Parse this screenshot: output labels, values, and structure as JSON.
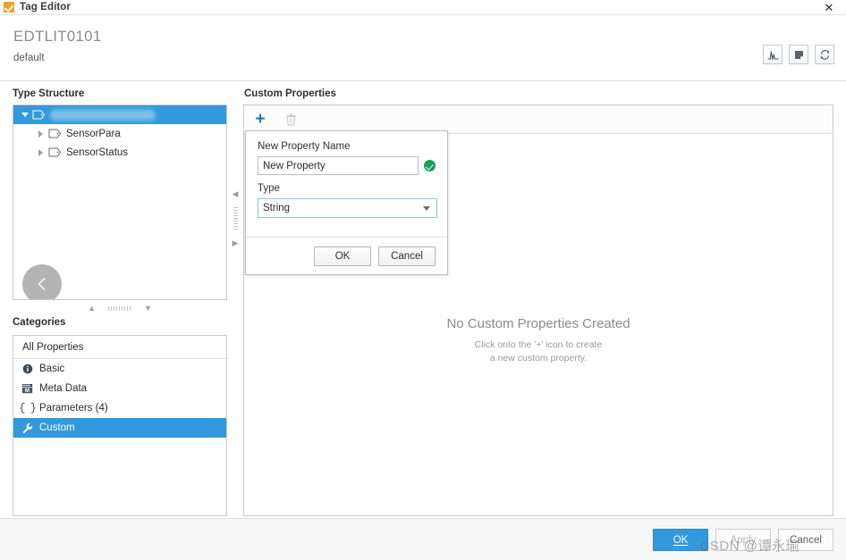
{
  "window": {
    "title": "Tag Editor",
    "icon": "tag-editor-icon",
    "close_label": "✕"
  },
  "header": {
    "title": "EDTLIT0101",
    "subtitle": "default",
    "tools": [
      {
        "name": "trend-chart-icon",
        "title": "Trend"
      },
      {
        "name": "note-icon",
        "title": "Note"
      },
      {
        "name": "refresh-icon",
        "title": "Refresh"
      }
    ]
  },
  "type_structure": {
    "label": "Type Structure",
    "nodes": [
      {
        "label": "",
        "redacted": true,
        "expanded": true,
        "selected": true,
        "level": 0
      },
      {
        "label": "SensorPara",
        "redacted": false,
        "expanded": false,
        "selected": false,
        "level": 1
      },
      {
        "label": "SensorStatus",
        "redacted": false,
        "expanded": false,
        "selected": false,
        "level": 1
      }
    ],
    "back_button": "back-circle-button"
  },
  "categories": {
    "label": "Categories",
    "all_label": "All Properties",
    "items": [
      {
        "label": "Basic",
        "icon": "info-icon",
        "selected": false
      },
      {
        "label": "Meta Data",
        "icon": "database-icon",
        "selected": false
      },
      {
        "label": "Parameters (4)",
        "icon": "braces-icon",
        "selected": false
      },
      {
        "label": "Custom",
        "icon": "wrench-icon",
        "selected": true
      }
    ]
  },
  "custom_properties": {
    "label": "Custom Properties",
    "toolbar": {
      "add_label": "+",
      "add_name": "add-property-icon",
      "delete_name": "delete-property-icon"
    },
    "empty_title": "No Custom Properties Created",
    "empty_line1": "Click onto the '+' icon to create",
    "empty_line2": "a new custom property."
  },
  "dialog": {
    "name_label": "New Property Name",
    "name_value": "New Property",
    "name_placeholder": "New Property",
    "valid_icon": "valid-check-icon",
    "type_label": "Type",
    "type_value": "String",
    "ok_label": "OK",
    "cancel_label": "Cancel"
  },
  "footer": {
    "ok_label": "OK",
    "apply_label": "Apply",
    "cancel_label": "Cancel",
    "watermark": "CSDN @谭永瑜"
  },
  "colors": {
    "accent": "#3399dd",
    "selection": "#3399dd",
    "valid_green": "#12a05c",
    "icon_blue": "#2f73b3",
    "title_icon_orange": "#f0a030"
  }
}
